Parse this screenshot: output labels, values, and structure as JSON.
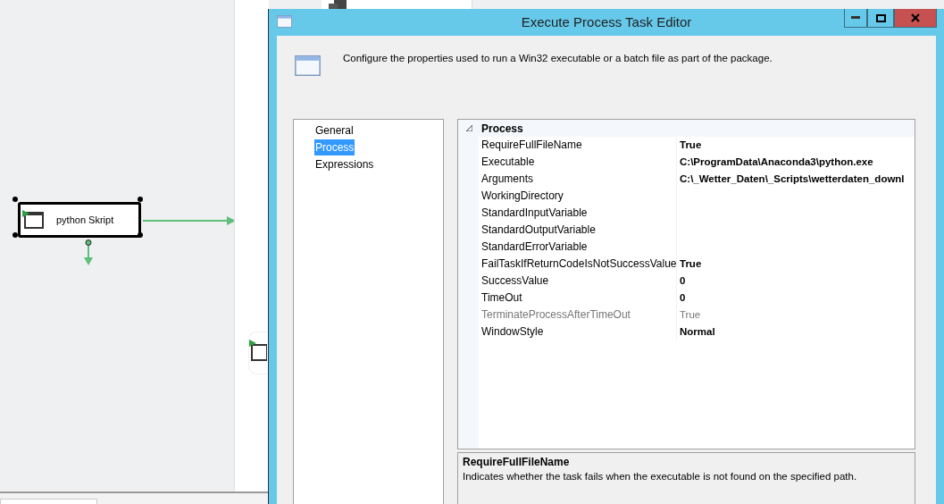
{
  "canvas": {
    "node": {
      "label": "python Skript",
      "selected": true
    }
  },
  "dialog": {
    "title": "Execute Process Task Editor",
    "header_text": "Configure the properties used to run a Win32 executable or a batch file as part of the package.",
    "nav_items": [
      {
        "label": "General",
        "selected": false
      },
      {
        "label": "Process",
        "selected": true
      },
      {
        "label": "Expressions",
        "selected": false
      }
    ],
    "property_grid": {
      "category": "Process",
      "expanded": true,
      "rows": [
        {
          "name": "RequireFullFileName",
          "value": "True",
          "disabled": false
        },
        {
          "name": "Executable",
          "value": "C:\\ProgramData\\Anaconda3\\python.exe",
          "disabled": false
        },
        {
          "name": "Arguments",
          "value": "C:\\_Wetter_Daten\\_Scripts\\wetterdaten_downl",
          "disabled": false
        },
        {
          "name": "WorkingDirectory",
          "disabled": false
        },
        {
          "name": "StandardInputVariable",
          "disabled": false
        },
        {
          "name": "StandardOutputVariable",
          "disabled": false
        },
        {
          "name": "StandardErrorVariable",
          "disabled": false
        },
        {
          "name": "FailTaskIfReturnCodeIsNotSuccessValue",
          "value": "True",
          "disabled": false
        },
        {
          "name": "SuccessValue",
          "value": "0",
          "disabled": false
        },
        {
          "name": "TimeOut",
          "value": "0",
          "disabled": false
        },
        {
          "name": "TerminateProcessAfterTimeOut",
          "value": "True",
          "disabled": true
        },
        {
          "name": "WindowStyle",
          "value": "Normal",
          "disabled": false
        }
      ]
    },
    "description": {
      "title": "RequireFullFileName",
      "text": "Indicates whether the task fails when the executable is not found on the specified path."
    }
  }
}
